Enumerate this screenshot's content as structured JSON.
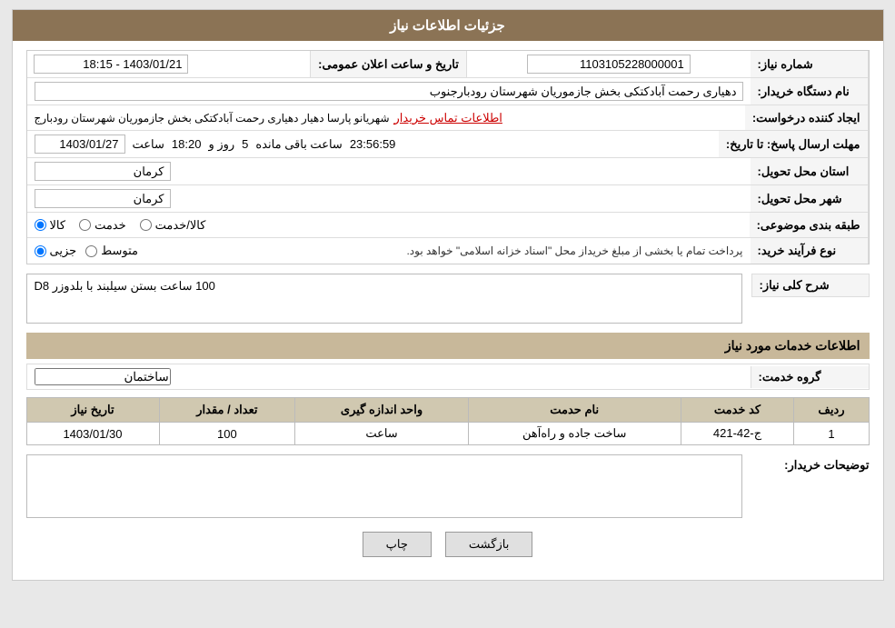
{
  "page": {
    "title": "جزئیات اطلاعات نیاز"
  },
  "header": {
    "need_number_label": "شماره نیاز:",
    "need_number_value": "1103105228000001",
    "date_label": "تاریخ و ساعت اعلان عمومی:",
    "date_value": "1403/01/21 - 18:15",
    "org_name_label": "نام دستگاه خریدار:",
    "org_name_value": "دهیاری رحمت آبادکتکی بخش جازموریان شهرستان رودبارجنوب",
    "creator_label": "ایجاد کننده درخواست:",
    "creator_value": "شهریانو پارسا دهیار دهیاری رحمت آبادکتکی بخش جازموریان شهرستان رودبارج",
    "creator_link": "اطلاعات تماس خریدار",
    "deadline_label": "مهلت ارسال پاسخ: تا تاریخ:",
    "deadline_date": "1403/01/27",
    "deadline_time_label": "ساعت",
    "deadline_time": "18:20",
    "deadline_day_label": "روز و",
    "deadline_days": "5",
    "deadline_remaining_label": "ساعت باقی مانده",
    "deadline_remaining": "23:56:59",
    "province_label": "استان محل تحویل:",
    "province_value": "کرمان",
    "city_label": "شهر محل تحویل:",
    "city_value": "کرمان",
    "category_label": "طبقه بندی موضوعی:",
    "category_kala": "کالا",
    "category_khedmat": "خدمت",
    "category_kala_khedmat": "کالا/خدمت",
    "process_label": "نوع فرآیند خرید:",
    "process_jozvi": "جزیی",
    "process_motavaset": "متوسط",
    "process_notice": "پرداخت تمام یا بخشی از مبلغ خریداز محل \"اسناد خزانه اسلامی\" خواهد بود.",
    "summary_label": "شرح کلی نیاز:",
    "summary_value": "100 ساعت بستن سیلبند با بلدوزر D8"
  },
  "services": {
    "section_title": "اطلاعات خدمات مورد نیاز",
    "group_label": "گروه خدمت:",
    "group_value": "ساختمان",
    "table": {
      "columns": [
        "ردیف",
        "کد خدمت",
        "نام حدمت",
        "واحد اندازه گیری",
        "تعداد / مقدار",
        "تاریخ نیاز"
      ],
      "rows": [
        {
          "row": "1",
          "code": "ج-42-421",
          "name": "ساخت جاده و راه‌آهن",
          "unit": "ساعت",
          "qty": "100",
          "date": "1403/01/30"
        }
      ]
    }
  },
  "buyer_desc": {
    "label": "توضیحات خریدار:"
  },
  "buttons": {
    "back": "بازگشت",
    "print": "چاپ"
  }
}
